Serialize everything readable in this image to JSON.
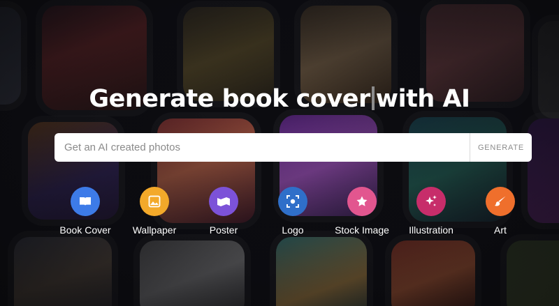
{
  "hero": {
    "title_part1": "Generate book cover",
    "title_part2": "with AI"
  },
  "search": {
    "placeholder": "Get an AI created photos",
    "value": "",
    "button_label": "GENERATE"
  },
  "categories": [
    {
      "label": "Book Cover",
      "icon": "book-icon",
      "color": "#3d7be8"
    },
    {
      "label": "Wallpaper",
      "icon": "image-icon",
      "color": "#f3a92a"
    },
    {
      "label": "Poster",
      "icon": "map-icon",
      "color": "#7c52d8"
    },
    {
      "label": "Logo",
      "icon": "focus-icon",
      "color": "#2f6fc9"
    },
    {
      "label": "Stock Image",
      "icon": "star-icon",
      "color": "#e2568f"
    },
    {
      "label": "Illustration",
      "icon": "sparkle-icon",
      "color": "#c72d6a"
    },
    {
      "label": "Art",
      "icon": "brush-icon",
      "color": "#ef6f2c"
    }
  ]
}
